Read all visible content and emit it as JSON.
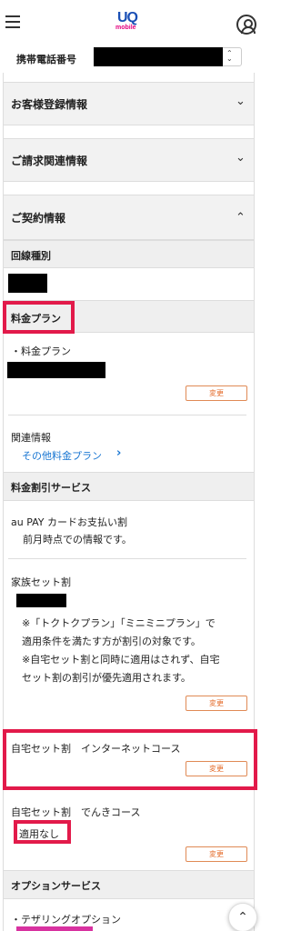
{
  "header": {
    "logo_top": "UQ",
    "logo_bottom": "mobile"
  },
  "phone": {
    "label": "携帯電話番号",
    "arrow": "⌃⌄"
  },
  "accordions": [
    {
      "label": "お客様登録情報",
      "chevron": "⌄"
    },
    {
      "label": "ご請求関連情報",
      "chevron": "⌄"
    },
    {
      "label": "ご契約情報",
      "chevron": "⌃"
    }
  ],
  "contract": {
    "line_type_heading": "回線種別",
    "plan_heading": "料金プラン",
    "plan_item_label": "・料金プラン",
    "change_label": "変更",
    "related_label": "関連情報",
    "other_plans_link": "その他料金プラン",
    "other_plans_chevron": "›"
  },
  "discounts": {
    "heading": "料金割引サービス",
    "au_pay_title": "au PAY カードお支払い割",
    "au_pay_note": "前月時点での情報です。",
    "family_title": "家族セット割",
    "family_note_1": "※「トクトクプラン」「ミニミニプラン」で",
    "family_note_2": "適用条件を満たす方が割引の対象です。",
    "family_note_3": "※自宅セット割と同時に適用はされず、自宅",
    "family_note_4": "セット割の割引が優先適用されます。",
    "home_internet_title": "自宅セット割　インターネットコース",
    "home_denki_title": "自宅セット割　でんきコース",
    "home_denki_status": "適用なし"
  },
  "options": {
    "heading": "オプションサービス",
    "tethering": "・テザリングオプション"
  },
  "scroll_top_glyph": "⌃"
}
